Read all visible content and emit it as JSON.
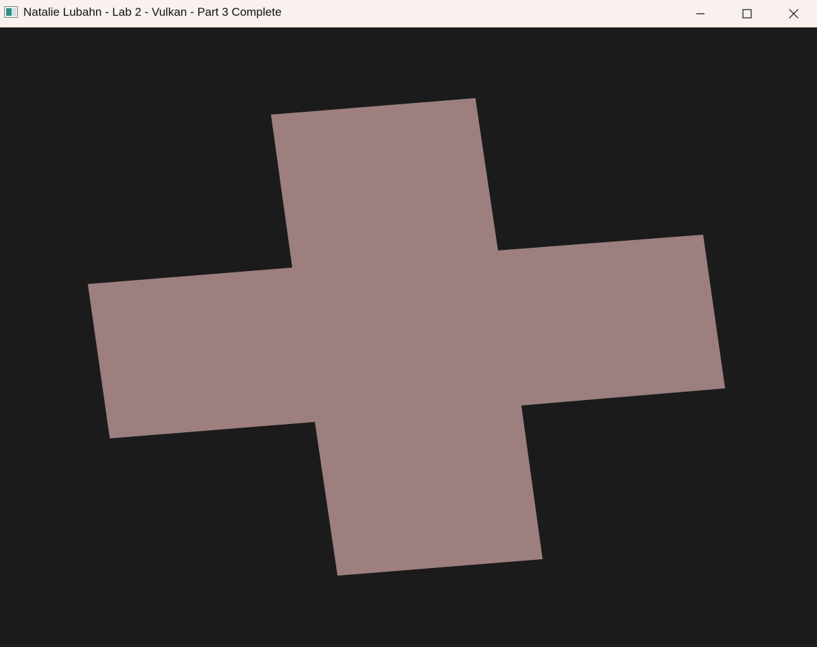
{
  "window": {
    "title": "Natalie Lubahn - Lab 2 - Vulkan - Part 3 Complete",
    "icon": "application-window-icon",
    "controls": {
      "minimize": "minimize-icon",
      "maximize": "maximize-icon",
      "close": "close-icon"
    }
  },
  "scene": {
    "shape": "cross",
    "fill_color": "#9d7f7f",
    "background_color": "#1b1b1b"
  },
  "colors": {
    "titlebar": "#f8f1ee",
    "title_text": "#111111"
  }
}
